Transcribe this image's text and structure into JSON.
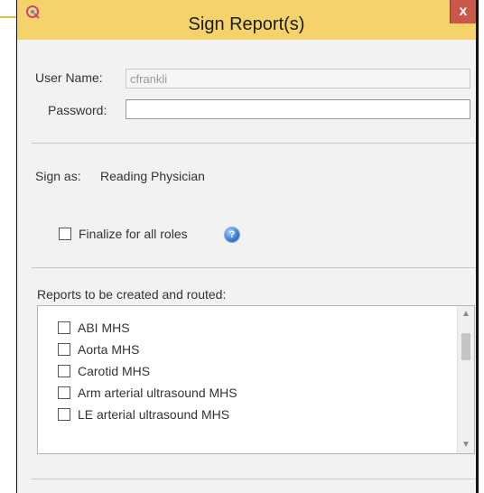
{
  "dialog": {
    "title": "Sign Report(s)",
    "close_label": "x"
  },
  "form": {
    "username_label": "User Name:",
    "username_value": "cfrankli",
    "password_label": "Password:",
    "password_value": "",
    "sign_as_label": "Sign as:",
    "sign_as_value": "Reading Physician",
    "finalize_label": "Finalize for all roles",
    "finalize_checked": false
  },
  "reports": {
    "label": "Reports to be created and routed:",
    "items": [
      {
        "label": "ABI MHS",
        "checked": false
      },
      {
        "label": "Aorta MHS",
        "checked": false
      },
      {
        "label": "Carotid MHS",
        "checked": false
      },
      {
        "label": "Arm arterial ultrasound MHS",
        "checked": false
      },
      {
        "label": "LE arterial ultrasound MHS",
        "checked": false
      }
    ]
  },
  "colors": {
    "titlebar": "#f6d36a",
    "close_button": "#c9584a",
    "help_icon": "#3d7fd6"
  },
  "icons": {
    "app": "app-icon",
    "help": "help-icon",
    "close": "close-icon"
  }
}
